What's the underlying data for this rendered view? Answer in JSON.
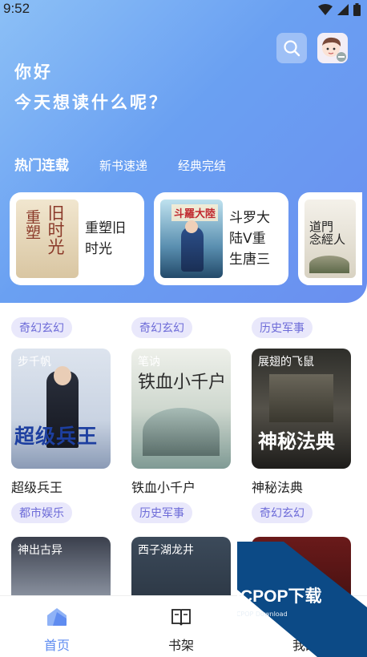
{
  "status": {
    "time": "9:52"
  },
  "greeting": {
    "line1": "你好",
    "line2": "今天想读什么呢？"
  },
  "tabs": [
    {
      "label": "热门连载",
      "active": true
    },
    {
      "label": "新书速递",
      "active": false
    },
    {
      "label": "经典完结",
      "active": false
    }
  ],
  "featured": [
    {
      "title": "重塑旧时光",
      "cover_text": "重塑旧时光"
    },
    {
      "title": "斗罗大陆V重生唐三",
      "cover_text": "斗罗大陆"
    },
    {
      "title": "",
      "cover_text": "道门念经人"
    }
  ],
  "partial_row": {
    "tags": [
      "奇幻玄幻",
      "奇幻玄幻",
      "历史军事"
    ]
  },
  "books": [
    {
      "name": "超级兵王",
      "tag": "都市娱乐",
      "cover_label": "步千帆",
      "cover_title": "超级兵王"
    },
    {
      "name": "铁血小千户",
      "tag": "历史军事",
      "cover_label": "笔讷",
      "cover_title": "铁血小千户"
    },
    {
      "name": "神秘法典",
      "tag": "奇幻玄幻",
      "cover_label": "展翅的飞鼠",
      "cover_title": "神秘法典"
    }
  ],
  "books_row3": [
    {
      "cover_label": "神出古异"
    },
    {
      "cover_label": "西子湖龙井"
    },
    {
      "cover_label": ""
    }
  ],
  "nav": [
    {
      "label": "首页",
      "active": true,
      "icon": "home-icon"
    },
    {
      "label": "书架",
      "active": false,
      "icon": "book-icon"
    },
    {
      "label": "我的",
      "active": false,
      "icon": "user-icon"
    }
  ],
  "watermark": {
    "brand": "PCPOP下载",
    "sub": "PCPOP Download"
  },
  "colors": {
    "accent": "#6a8ff0",
    "tag_bg": "#e9e8fb",
    "tag_text": "#6d6bd8"
  }
}
